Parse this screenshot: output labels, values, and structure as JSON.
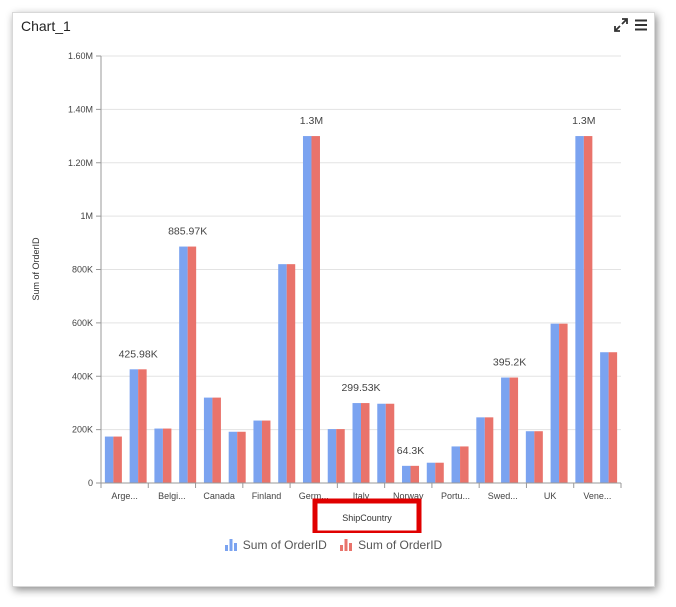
{
  "window": {
    "title": "Chart_1"
  },
  "icons": {
    "expand": "expand-icon",
    "menu": "hamburger-menu-icon"
  },
  "colors": {
    "series1": "#7ba3f0",
    "series2": "#e9736b",
    "highlight": "#e00000"
  },
  "chart_data": {
    "type": "bar",
    "categories": [
      "Arge...",
      "Belgi...",
      "Canada",
      "Finland",
      "Germ...",
      "Italy",
      "Norway",
      "Portu...",
      "Swed...",
      "UK",
      "Vene..."
    ],
    "series": [
      {
        "name": "Sum of OrderID",
        "values": [
          174000,
          425980,
          204000,
          885970,
          320000,
          192000,
          234000,
          820000,
          1300000,
          202000,
          299530,
          297000,
          64300,
          76000,
          137000,
          246000,
          395200,
          194000,
          597000,
          1300000,
          490000
        ]
      },
      {
        "name": "Sum of OrderID",
        "values": [
          174000,
          425980,
          204000,
          885970,
          320000,
          192000,
          234000,
          820000,
          1300000,
          202000,
          299530,
          297000,
          64300,
          76000,
          137000,
          246000,
          395200,
          194000,
          597000,
          1300000,
          490000
        ]
      }
    ],
    "data_labels": [
      {
        "index": 1,
        "text": "425.98K"
      },
      {
        "index": 3,
        "text": "885.97K"
      },
      {
        "index": 8,
        "text": "1.3M"
      },
      {
        "index": 10,
        "text": "299.53K"
      },
      {
        "index": 12,
        "text": "64.3K"
      },
      {
        "index": 16,
        "text": "395.2K"
      },
      {
        "index": 19,
        "text": "1.3M"
      }
    ],
    "title": "",
    "xlabel": "ShipCountry",
    "ylabel": "Sum of OrderID",
    "ylim": [
      0,
      1600000
    ],
    "yticks": [
      {
        "value": 0,
        "label": "0"
      },
      {
        "value": 200000,
        "label": "200K"
      },
      {
        "value": 400000,
        "label": "400K"
      },
      {
        "value": 600000,
        "label": "600K"
      },
      {
        "value": 800000,
        "label": "800K"
      },
      {
        "value": 1000000,
        "label": "1M"
      },
      {
        "value": 1200000,
        "label": "1.20M"
      },
      {
        "value": 1400000,
        "label": "1.40M"
      },
      {
        "value": 1600000,
        "label": "1.60M"
      }
    ],
    "grid": true,
    "legend": "bottom",
    "xlabel_highlighted": true
  }
}
